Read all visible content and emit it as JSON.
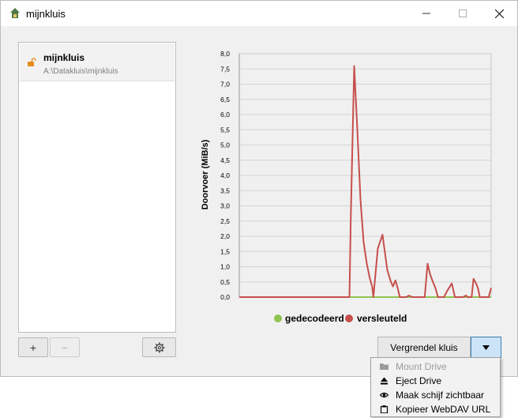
{
  "window": {
    "title": "mijnkluis",
    "app_icon": "cryptomator-icon"
  },
  "vault_list": {
    "items": [
      {
        "name": "mijnkluis",
        "path": "A:\\Datakluis\\mijnkluis",
        "status_icon": "unlocked-padlock-icon"
      }
    ]
  },
  "toolbar": {
    "add_label": "+",
    "remove_label": "−",
    "settings_icon": "gear-icon"
  },
  "chart_data": {
    "type": "line",
    "ylabel": "Doorvoer (MiB/s)",
    "xlabel": "",
    "ylim": [
      0,
      8
    ],
    "yticks": [
      "0,0",
      "0,5",
      "1,0",
      "1,5",
      "2,0",
      "2,5",
      "3,0",
      "3,5",
      "4,0",
      "4,5",
      "5,0",
      "5,5",
      "6,0",
      "6,5",
      "7,0",
      "7,5",
      "8,0"
    ],
    "grid": true,
    "legend_position": "bottom",
    "x": [
      0,
      1,
      2,
      3,
      4,
      5,
      6,
      7,
      8,
      9,
      10,
      11,
      12,
      13,
      14,
      15,
      16,
      17,
      18,
      19,
      20,
      21,
      22,
      23,
      24,
      25,
      26,
      27,
      28,
      29,
      30,
      31,
      32,
      33,
      34,
      35,
      36,
      37,
      38,
      39,
      40,
      41,
      42,
      43,
      44,
      45,
      46,
      47,
      48,
      49,
      50,
      51,
      52,
      53,
      54,
      55,
      56,
      57,
      58,
      59,
      60,
      61,
      62,
      63,
      64,
      65,
      66,
      67,
      68,
      69,
      70,
      71,
      72,
      73,
      74,
      75,
      76,
      77,
      78,
      79,
      80
    ],
    "series": [
      {
        "name": "gedecodeerd",
        "color": "#8ec44f",
        "values": [
          0,
          0,
          0,
          0,
          0,
          0,
          0,
          0,
          0,
          0,
          0,
          0,
          0,
          0,
          0,
          0,
          0,
          0,
          0,
          0,
          0,
          0,
          0,
          0,
          0,
          0,
          0,
          0,
          0,
          0,
          0,
          0,
          0,
          0,
          0,
          0,
          0,
          0,
          0,
          0,
          0,
          0,
          0,
          0,
          0,
          0,
          0,
          0,
          0,
          0,
          0,
          0,
          0,
          0,
          0,
          0,
          0,
          0,
          0,
          0,
          0,
          0,
          0,
          0,
          0,
          0,
          0,
          0,
          0,
          0,
          0,
          0,
          0,
          0,
          0,
          0,
          0,
          0,
          0,
          0,
          0
        ]
      },
      {
        "name": "versleuteld",
        "color": "#c64f4c",
        "values": [
          0,
          0,
          0,
          0,
          0,
          0,
          0,
          0,
          0,
          0,
          0,
          0,
          0,
          0,
          0,
          0,
          0,
          0,
          0,
          0,
          0,
          0,
          0,
          0,
          0,
          0,
          0,
          0,
          0,
          0,
          0,
          0,
          0,
          0,
          0,
          0,
          0,
          0,
          0,
          0,
          0,
          0,
          0,
          0,
          0,
          0,
          7.6,
          6.0,
          3.4,
          2.0,
          1.2,
          0.7,
          0.4,
          0.05,
          1.2,
          2.05,
          1.1,
          0.7,
          0.4,
          0.5,
          0.3,
          0,
          0,
          0,
          0,
          0.05,
          0,
          0,
          0,
          0.05,
          0,
          0,
          0,
          0,
          0,
          1.1,
          0.7,
          0.4,
          0,
          0,
          0.05
        ]
      }
    ]
  },
  "chart_points": {
    "versleuteld_x": [
      0,
      35,
      35.4,
      36.5,
      37.5,
      38.5,
      39.5,
      40.5,
      41.5,
      42.2,
      42.6,
      44,
      45.5,
      47,
      48,
      48.8,
      49.6,
      50.3,
      51,
      53,
      53.8,
      55,
      58,
      58.9,
      59.8,
      60.6,
      61.5,
      62.3,
      63.1,
      63.8,
      65,
      66,
      67.5,
      68.5,
      71,
      72,
      72.6,
      73.2,
      73.8,
      74.4,
      75.2,
      75.8,
      76.4,
      77.1,
      79.2,
      80
    ],
    "versleuteld_y": [
      0,
      0,
      2.5,
      7.6,
      5.5,
      3.2,
      1.8,
      1.1,
      0.6,
      0.35,
      0.0,
      1.6,
      2.05,
      0.9,
      0.55,
      0.35,
      0.55,
      0.3,
      0.0,
      0.0,
      0.05,
      0.0,
      0.0,
      0.0,
      1.1,
      0.75,
      0.5,
      0.3,
      0.0,
      0.0,
      0.0,
      0.2,
      0.45,
      0.0,
      0.0,
      0.05,
      0.0,
      0.0,
      0.0,
      0.6,
      0.45,
      0.3,
      0.0,
      0.0,
      0.0,
      0.3
    ]
  },
  "lock_button": {
    "label": "Vergrendel kluis",
    "dropdown_icon": "dropdown-triangle-icon"
  },
  "dropdown_menu": {
    "items": [
      {
        "label": "Mount Drive",
        "icon": "folder-icon",
        "enabled": false
      },
      {
        "label": "Eject Drive",
        "icon": "eject-icon",
        "enabled": true
      },
      {
        "label": "Maak schijf zichtbaar",
        "icon": "eye-icon",
        "enabled": true
      },
      {
        "label": "Kopieer WebDAV URL",
        "icon": "clipboard-icon",
        "enabled": true
      }
    ]
  }
}
